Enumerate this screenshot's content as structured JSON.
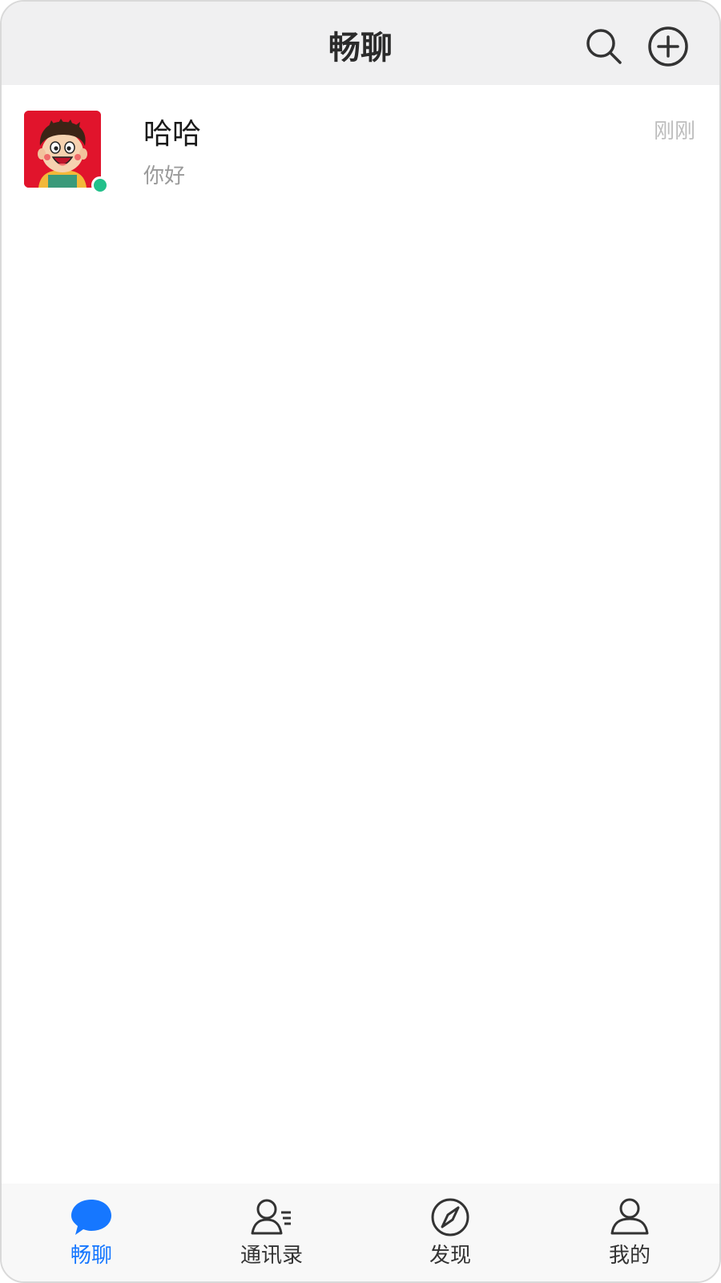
{
  "header": {
    "title": "畅聊",
    "search_icon": "search-icon",
    "add_icon": "plus-circle-icon"
  },
  "chats": [
    {
      "name": "哈哈",
      "preview": "你好",
      "time": "刚刚",
      "online": true,
      "avatar_icon": "cartoon-boy-avatar"
    }
  ],
  "tabs": [
    {
      "label": "畅聊",
      "icon": "chat-bubble-icon",
      "active": true
    },
    {
      "label": "通讯录",
      "icon": "contacts-icon",
      "active": false
    },
    {
      "label": "发现",
      "icon": "compass-icon",
      "active": false
    },
    {
      "label": "我的",
      "icon": "user-icon",
      "active": false
    }
  ],
  "colors": {
    "accent": "#1677ff",
    "online": "#22c08a",
    "header_bg": "#f0f0f1",
    "avatar_bg": "#e1142c"
  }
}
